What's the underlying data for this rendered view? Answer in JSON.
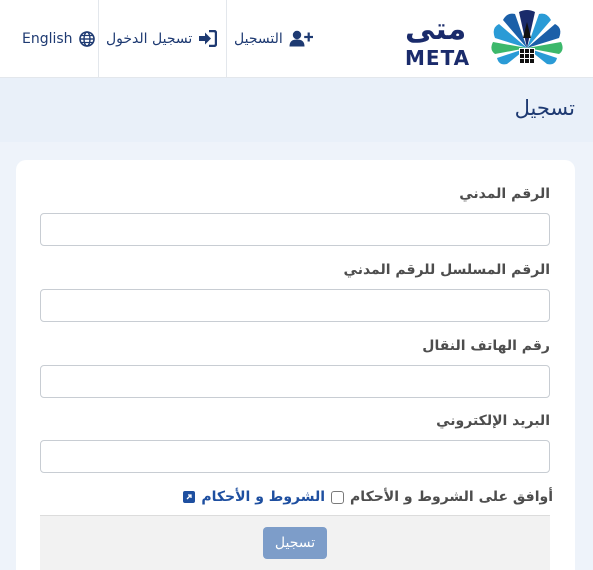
{
  "header": {
    "language_label": "English",
    "login_label": "تسجيل الدخول",
    "register_label": "التسجيل",
    "logo_ar": "متى",
    "logo_en": "META"
  },
  "page": {
    "title": "تسجيل"
  },
  "form": {
    "fields": [
      {
        "label": "الرقم المدني",
        "value": ""
      },
      {
        "label": "الرقم المسلسل للرقم المدني",
        "value": ""
      },
      {
        "label": "رقم الهاتف النقال",
        "value": ""
      },
      {
        "label": "البريد الإلكتروني",
        "value": ""
      }
    ],
    "terms_link_label": "الشروط و الأحكام",
    "agree_label": "أوافق على الشروط و الأحكام",
    "agree_checked": false,
    "submit_label": "تسجيل"
  },
  "colors": {
    "brand_navy": "#1e3a72",
    "submit_disabled": "#7d9dc9",
    "page_background": "#eef3fa"
  }
}
